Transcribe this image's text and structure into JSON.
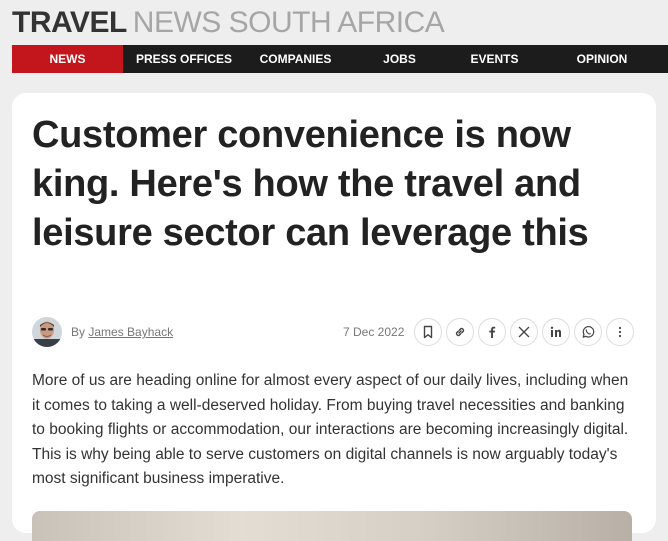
{
  "masthead": {
    "part1": "TRAVEL",
    "part2": "NEWS SOUTH AFRICA"
  },
  "nav": {
    "items": [
      {
        "label": "NEWS",
        "active": true
      },
      {
        "label": "PRESS OFFICES",
        "active": false
      },
      {
        "label": "COMPANIES",
        "active": false
      },
      {
        "label": "JOBS",
        "active": false
      },
      {
        "label": "EVENTS",
        "active": false
      },
      {
        "label": "OPINION",
        "active": false
      }
    ]
  },
  "article": {
    "headline": "Customer convenience is now king. Here's how the travel and leisure sector can leverage this",
    "byline_prefix": "By",
    "author": "James Bayhack",
    "date": "7 Dec 2022",
    "share_icons": [
      "bookmark-icon",
      "link-icon",
      "facebook-icon",
      "x-icon",
      "linkedin-icon",
      "whatsapp-icon",
      "more-icon"
    ],
    "lede": "More of us are heading online for almost every aspect of our daily lives, including when it comes to taking a well-deserved holiday. From buying travel necessities and banking to booking flights or accommodation, our interactions are becoming increasingly digital. This is why being able to serve customers on digital channels is now arguably today's most significant business imperative."
  },
  "colors": {
    "accent": "#c3161c",
    "nav_bg": "#1c1c1c",
    "page_bg": "#eeeeee",
    "card_bg": "#ffffff",
    "headline": "#222222"
  }
}
